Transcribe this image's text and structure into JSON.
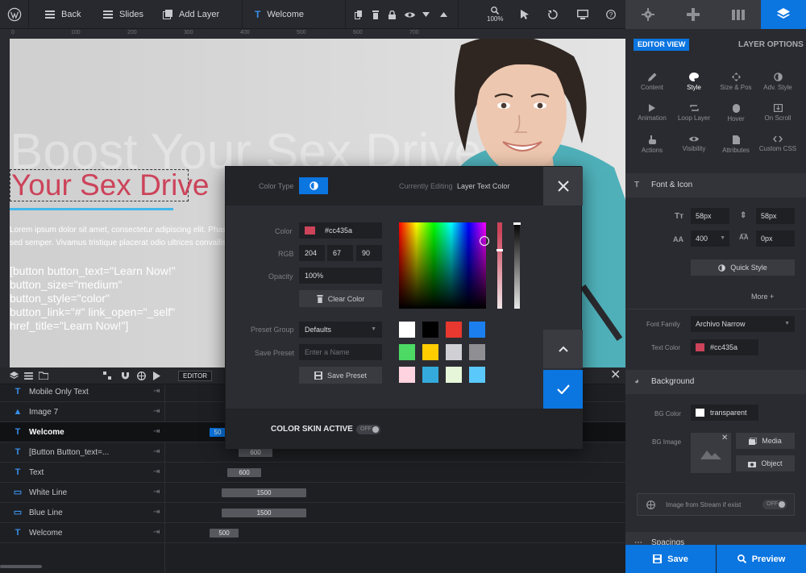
{
  "toolbar": {
    "back_label": "Back",
    "slides_label": "Slides",
    "add_layer_label": "Add Layer",
    "layer_name": "Welcome",
    "zoom_label": "100%"
  },
  "ruler": {
    "ticks": [
      "0",
      "100",
      "200",
      "300",
      "400",
      "500",
      "600",
      "700"
    ]
  },
  "canvas": {
    "ghost_text": "Boost Your Sex Drive",
    "headline": "Your Sex Drive",
    "headline_color": "#cc435a",
    "lorem": "Lorem ipsum dolor sit amet, consectetur adipiscing elit. Phasellus\nsed semper. Vivamus tristique placerat odio ultrices convallis.",
    "button_code": "[button button_text=\"Learn Now!\"\nbutton_size=\"medium\"\nbutton_style=\"color\"\nbutton_link=\"#\" link_open=\"_self\"\nhref_title=\"Learn Now!\"]"
  },
  "timeline": {
    "editor_label": "EDITOR",
    "rows": [
      {
        "name": "Mobile Only Text",
        "icon": "T",
        "bar": ""
      },
      {
        "name": "Image 7",
        "icon": "▲",
        "bar": ""
      },
      {
        "name": "Welcome",
        "icon": "T",
        "bar": "50"
      },
      {
        "name": "[Button Button_text=...",
        "icon": "T",
        "bar": "600"
      },
      {
        "name": "Text",
        "icon": "T",
        "bar": "600"
      },
      {
        "name": "White Line",
        "icon": "▭",
        "bar": "1500"
      },
      {
        "name": "Blue Line",
        "icon": "▭",
        "bar": "1500"
      },
      {
        "name": "Welcome",
        "icon": "T",
        "bar": "500"
      }
    ]
  },
  "color_modal": {
    "color_type_label": "Color Type",
    "currently_editing_label": "Currently Editing",
    "editing_target": "Layer Text Color",
    "color_label": "Color",
    "color_hex": "#cc435a",
    "rgb_label": "RGB",
    "rgb": [
      "204",
      "67",
      "90"
    ],
    "opacity_label": "Opacity",
    "opacity": "100%",
    "clear_color_label": "Clear Color",
    "preset_group_label": "Preset Group",
    "preset_group_value": "Defaults",
    "save_preset_label": "Save Preset",
    "preset_name_placeholder": "Enter a Name",
    "save_preset_button": "Save Preset",
    "presets": [
      "#ffffff",
      "#000000",
      "#e8382f",
      "#1b7ff0",
      "#4cd964",
      "#ffcc00",
      "#cfcfd4",
      "#8e8e93",
      "#ffd3e0",
      "#34aadc",
      "#e6f7d9",
      "#5ac8fa"
    ],
    "skin_label": "COLOR SKIN ACTIVE",
    "skin_toggle": "OFF"
  },
  "right_panel": {
    "editor_view_label": "EDITOR VIEW",
    "layer_options_label": "LAYER OPTIONS",
    "options": [
      {
        "label": "Content",
        "icon": "pencil-icon"
      },
      {
        "label": "Style",
        "icon": "palette-icon"
      },
      {
        "label": "Size & Pos",
        "icon": "move-icon"
      },
      {
        "label": "Adv. Style",
        "icon": "contrast-icon"
      },
      {
        "label": "Animation",
        "icon": "play-icon"
      },
      {
        "label": "Loop Layer",
        "icon": "loop-icon"
      },
      {
        "label": "Hover",
        "icon": "mouse-icon"
      },
      {
        "label": "On Scroll",
        "icon": "scroll-icon"
      },
      {
        "label": "Actions",
        "icon": "hand-icon"
      },
      {
        "label": "Visibility",
        "icon": "eye-icon"
      },
      {
        "label": "Attributes",
        "icon": "file-icon"
      },
      {
        "label": "Custom CSS",
        "icon": "code-icon"
      }
    ],
    "font_section": "Font & Icon",
    "font_size": "58px",
    "line_height": "58px",
    "font_weight": "400",
    "letter_spacing": "0px",
    "quick_style_label": "Quick Style",
    "more_label": "More",
    "font_family_label": "Font Family",
    "font_family_value": "Archivo Narrow",
    "text_color_label": "Text Color",
    "text_color_value": "#cc435a",
    "background_section": "Background",
    "bg_color_label": "BG Color",
    "bg_color_value": "transparent",
    "bg_image_label": "BG Image",
    "media_label": "Media",
    "object_label": "Object",
    "stream_label": "Image from Stream if exist",
    "stream_toggle": "OFF",
    "spacings_section": "Spacings",
    "save_label": "Save",
    "preview_label": "Preview"
  },
  "colors": {
    "accent": "#0b75e0",
    "text_color": "#cc435a"
  }
}
